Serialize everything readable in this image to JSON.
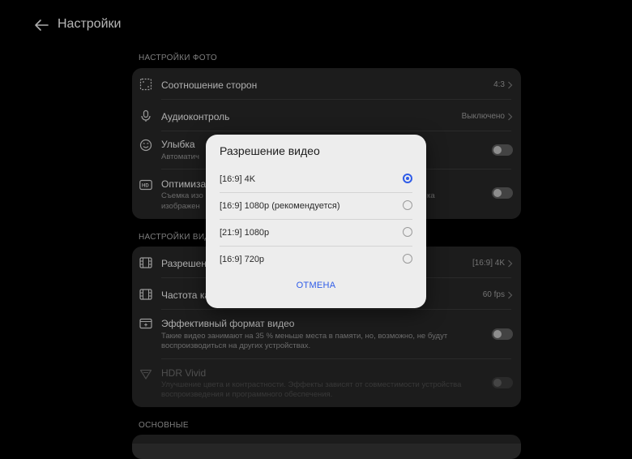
{
  "header": {
    "title": "Настройки"
  },
  "sections": {
    "photo": "НАСТРОЙКИ ФОТО",
    "video": "НАСТРОЙКИ ВИД",
    "basic": "ОСНОВНЫЕ"
  },
  "photo_rows": {
    "aspect": {
      "label": "Соотношение сторон",
      "value": "4:3"
    },
    "audio": {
      "label": "Аудиоконтроль",
      "value": "Выключено"
    },
    "smile": {
      "label": "Улыбка",
      "sub": "Автоматич"
    },
    "optim": {
      "label": "Оптимиза",
      "sub1": "Съемка изо",
      "sub2": "изображен",
      "sub_right": "ка"
    }
  },
  "video_rows": {
    "resolution": {
      "label": "Разрешени",
      "value": "[16:9] 4K"
    },
    "framerate": {
      "label": "Частота ка",
      "value": "60 fps"
    },
    "efficient": {
      "label": "Эффективный формат видео",
      "sub": "Такие видео занимают на 35 % меньше места в памяти, но, возможно, не будут воспроизводиться на других устройствах."
    },
    "hdr": {
      "label": "HDR Vivid",
      "sub": "Улучшение цвета и контрастности. Эффекты зависят от совместимости устройства воспроизведения и программного обеспечения."
    }
  },
  "dialog": {
    "title": "Разрешение видео",
    "options": [
      {
        "label": "[16:9] 4K",
        "selected": true
      },
      {
        "label": "[16:9] 1080p (рекомендуется)",
        "selected": false
      },
      {
        "label": "[21:9] 1080p",
        "selected": false
      },
      {
        "label": "[16:9] 720p",
        "selected": false
      }
    ],
    "cancel": "ОТМЕНА"
  },
  "colors": {
    "accent": "#2f5ce8",
    "card": "#262626",
    "background": "#000000"
  }
}
